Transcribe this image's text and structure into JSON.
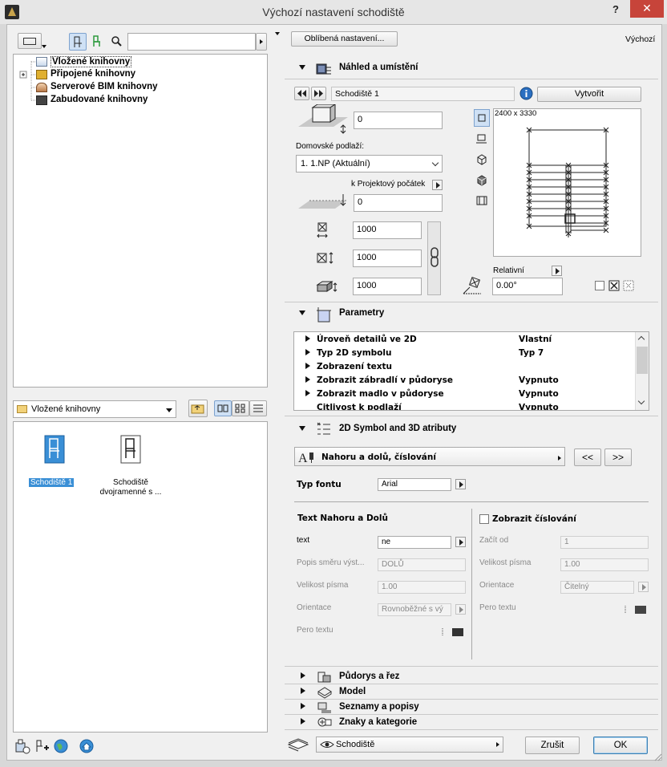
{
  "window": {
    "title": "Výchozí nastavení schodiště",
    "help": "?",
    "close": "✕"
  },
  "tree": {
    "items": [
      {
        "label": "Vložené knihovny"
      },
      {
        "label": "Připojené knihovny"
      },
      {
        "label": "Serverové BIM knihovny"
      },
      {
        "label": "Zabudované knihovny"
      }
    ]
  },
  "library_select": {
    "value": "Vložené knihovny"
  },
  "preview_items": [
    {
      "label": "Schodiště 1",
      "selected": true
    },
    {
      "label_line1": "Schodiště",
      "label_line2": "dvojramenné s ..."
    }
  ],
  "header": {
    "favorites": "Oblíbená nastavení...",
    "default_label": "Výchozí"
  },
  "section_preview": {
    "title": "Náhled a umístění",
    "name_value": "Schodiště 1",
    "create_button": "Vytvořit",
    "offset_value": "0",
    "home_story_label": "Domovské podlaží:",
    "home_story_value": "1. 1.NP (Aktuální)",
    "ref_label": "k Projektový počátek",
    "ref_value": "0",
    "width_value": "1000",
    "length_value": "1000",
    "height_value": "1000",
    "preview_dims": "2400 x 3330",
    "relative_label": "Relativní",
    "angle_value": "0.00°"
  },
  "section_params": {
    "title": "Parametry",
    "rows": [
      {
        "name": "Úroveň detailů ve 2D",
        "value": "Vlastní"
      },
      {
        "name": "Typ 2D symbolu",
        "value": "Typ 7"
      },
      {
        "name": "Zobrazení textu",
        "value": ""
      },
      {
        "name": "Zobrazit zábradlí v půdoryse",
        "value": "Vypnuto"
      },
      {
        "name": "Zobrazit madlo v půdoryse",
        "value": "Vypnuto"
      },
      {
        "name": "Citlivost k podlaží",
        "value": "Vypnuto"
      }
    ]
  },
  "section_symbol": {
    "title": "2D Symbol and 3D atributy",
    "subpage": "Nahoru a dolů, číslování",
    "prev": "<<",
    "next": ">>",
    "font_label": "Typ fontu",
    "font_value": "Arial",
    "text_header": "Text Nahoru a Dolů",
    "text_label": "text",
    "text_value": "ne",
    "direction_label": "Popis směru výst...",
    "direction_value": "DOLŮ",
    "size_label": "Velikost písma",
    "size_value": "1.00",
    "orient_label": "Orientace",
    "orient_value": "Rovnoběžné s vý",
    "pen_label": "Pero textu",
    "numbering_header": "Zobrazit číslování",
    "start_label": "Začít od",
    "start_value": "1",
    "num_size_label": "Velikost písma",
    "num_size_value": "1.00",
    "num_orient_label": "Orientace",
    "num_orient_value": "Čitelný",
    "num_pen_label": "Pero textu"
  },
  "collapsed_sections": [
    {
      "title": "Půdorys a řez"
    },
    {
      "title": "Model"
    },
    {
      "title": "Seznamy a popisy"
    },
    {
      "title": "Znaky a kategorie"
    }
  ],
  "footer": {
    "layer_value": "Schodiště",
    "cancel": "Zrušit",
    "ok": "OK"
  }
}
